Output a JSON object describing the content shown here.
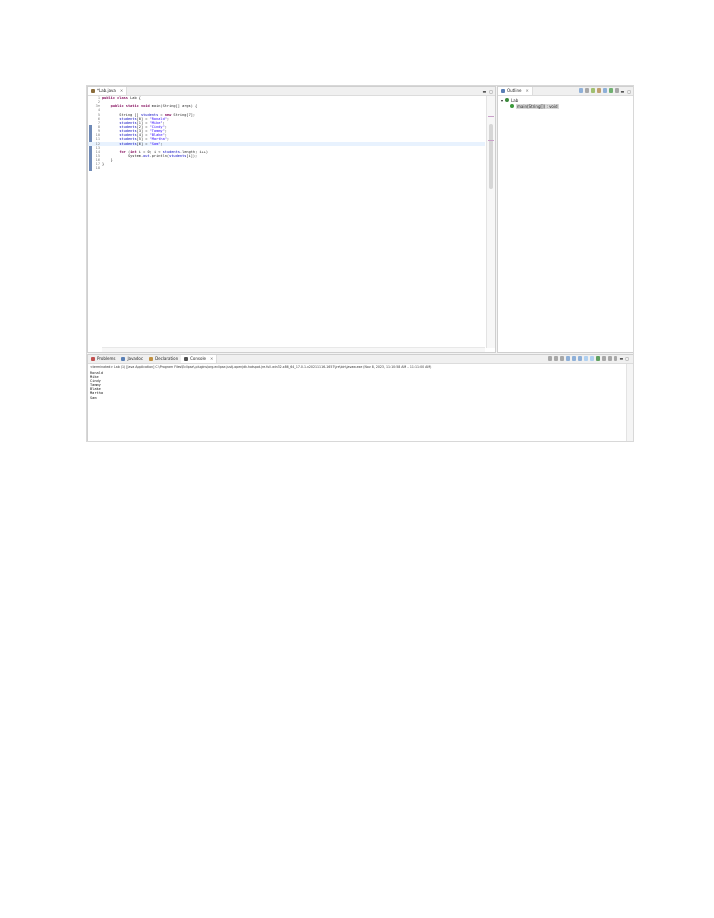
{
  "editor": {
    "tab_title": "*Lab.java",
    "lines": [
      {
        "n": "1",
        "html": "<span class='kw'>public class</span> Lab {"
      },
      {
        "n": "2",
        "html": ""
      },
      {
        "n": "3⊖",
        "html": "    <span class='kw'>public static void</span> main(String[] args) {"
      },
      {
        "n": "4",
        "html": ""
      },
      {
        "n": "5",
        "html": "        String [] <span class='var'>students</span> = <span class='kw'>new</span> String[7];"
      },
      {
        "n": "6",
        "html": "        <span class='var'>students</span>[0] = <span class='str'>\"Ronald\"</span>;"
      },
      {
        "n": "7",
        "html": "        <span class='var'>students</span>[1] = <span class='str'>\"Mike\"</span>;"
      },
      {
        "n": "8",
        "html": "        <span class='var'>students</span>[2] = <span class='str'>\"Cindy\"</span>;"
      },
      {
        "n": "9",
        "html": "        <span class='var'>students</span>[3] = <span class='str'>\"Tammy\"</span>;"
      },
      {
        "n": "10",
        "html": "        <span class='var'>students</span>[4] = <span class='str'>\"Blake\"</span>;"
      },
      {
        "n": "11",
        "html": "        <span class='var'>students</span>[5] = <span class='str'>\"Martha\"</span>;"
      },
      {
        "n": "12",
        "html": "        <span class='var'>students</span>[6] = <span class='str'>\"Sam\"</span>;",
        "hl": true
      },
      {
        "n": "13",
        "html": ""
      },
      {
        "n": "14",
        "html": "        <span class='kw'>for</span> (<span class='kw'>int</span> i = 0; i &lt; <span class='var'>students</span>.length; i++)"
      },
      {
        "n": "15",
        "html": "            System.<span class='var'>out</span>.println(<span class='var'>students</span>[i]);"
      },
      {
        "n": "16",
        "html": "    }"
      },
      {
        "n": "17",
        "html": "}"
      },
      {
        "n": "18",
        "html": ""
      }
    ]
  },
  "outline": {
    "tab_title": "Outline",
    "class_name": "Lab",
    "method": "main(String[]) : void"
  },
  "bottom_tabs": {
    "problems": "Problems",
    "javadoc": "Javadoc",
    "declaration": "Declaration",
    "console": "Console"
  },
  "console": {
    "header": "<terminated> Lab (1) [Java Application] C:\\Program Files\\Eclipse\\.plugins\\org.eclipse.justj.openjdk.hotspot.jre.full.win32.x86_64_17.0.1.v20211116-1657\\jre\\bin\\javaw.exe (Nov 8, 2023, 11:10:58 AM – 11:11:00 AM)",
    "output": [
      "Ronald",
      "Mike",
      "Cindy",
      "Tammy",
      "Blake",
      "Martha",
      "Sam"
    ]
  },
  "colors": {
    "keyword": "#7f0055",
    "string": "#2a00ff",
    "field": "#0000c0",
    "highlight": "#e8f2fe"
  }
}
